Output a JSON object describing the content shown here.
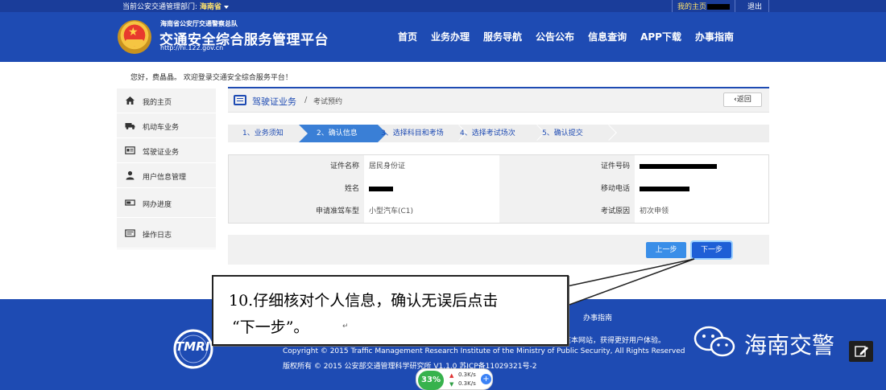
{
  "topbar": {
    "dept_label": "当前公安交通管理部门: ",
    "dept_value": "海南省",
    "my_home": "我的主页",
    "logout": "退出"
  },
  "header": {
    "org_sub": "海南省公安厅交通警察总队",
    "title": "交通安全综合服务管理平台",
    "url": "http://hi.122.gov.cn",
    "nav": [
      "首页",
      "业务办理",
      "服务导航",
      "公告公布",
      "信息查询",
      "APP下载",
      "办事指南"
    ]
  },
  "welcome": {
    "greeting": "您好，",
    "name": "费晶晶。",
    "message": "  欢迎登录交通安全综合服务平台！"
  },
  "sidebar": {
    "items": [
      {
        "label": "我的主页",
        "icon": "home-icon"
      },
      {
        "label": "机动车业务",
        "icon": "truck-icon"
      },
      {
        "label": "驾驶证业务",
        "icon": "id-card-icon"
      },
      {
        "label": "用户信息管理",
        "icon": "user-icon"
      },
      {
        "label": "网办进度",
        "icon": "progress-icon"
      },
      {
        "label": "操作日志",
        "icon": "log-icon"
      }
    ]
  },
  "panel": {
    "crumb_main": "驾驶证业务",
    "crumb_sep": "/",
    "crumb_sub": "考试预约",
    "back": "返回"
  },
  "steps": [
    "1、业务须知",
    "2、确认信息",
    "3、选择科目和考场",
    "4、选择考试场次",
    "5、确认提交"
  ],
  "info": {
    "rows": [
      {
        "label1": "证件名称",
        "value1": "居民身份证",
        "label2": "证件号码",
        "value2": ""
      },
      {
        "label1": "姓名",
        "value1": "",
        "label2": "移动电话",
        "value2": ""
      },
      {
        "label1": "申请准驾车型",
        "value1": "小型汽车(C1)",
        "label2": "考试原因",
        "value2": "初次申领"
      }
    ]
  },
  "buttons": {
    "prev": "上一步",
    "next": "下一步"
  },
  "footer": {
    "guide": "办事指南",
    "tmri": "TMRI",
    "hint": "览本网站，获得更好用户体验。",
    "copy1": "Copyright © 2015 Traffic Management Research Institute of the Ministry of Public Security, All Rights Reserved",
    "copy2": "版权所有 © 2015 公安部交通管理科学研究所 V1.1.0 苏ICP备11029321号-2"
  },
  "callout": {
    "line1": "10.仔细核对个人信息，确认无误后点击",
    "line2": "“下一步”。",
    "ret": "↵"
  },
  "watermark": {
    "text": "海南交警"
  },
  "net": {
    "pct": "33%",
    "up": "0.3K/s",
    "down": "0.3K/s",
    "plus": "+"
  }
}
